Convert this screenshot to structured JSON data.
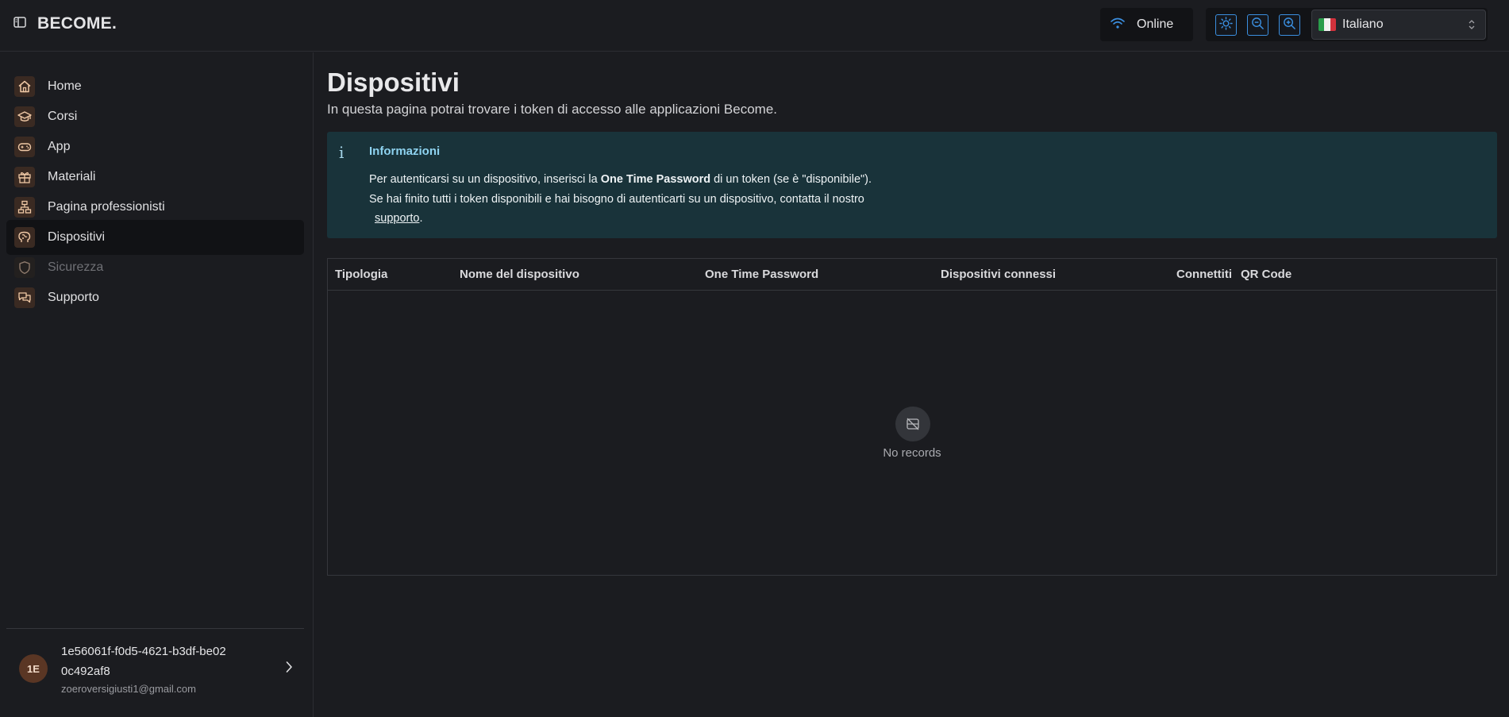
{
  "app": {
    "brand": "BECOME."
  },
  "header": {
    "status": "Online",
    "language": "Italiano",
    "accent_color": "#3b8fe0"
  },
  "sidebar": {
    "items": [
      {
        "label": "Home",
        "icon": "home-icon"
      },
      {
        "label": "Corsi",
        "icon": "graduation-cap-icon"
      },
      {
        "label": "App",
        "icon": "gamepad-icon"
      },
      {
        "label": "Materiali",
        "icon": "gift-icon"
      },
      {
        "label": "Pagina professionisti",
        "icon": "hierarchy-icon"
      },
      {
        "label": "Dispositivi",
        "icon": "brain-icon",
        "active": true
      },
      {
        "label": "Sicurezza",
        "icon": "shield-icon",
        "disabled": true
      },
      {
        "label": "Supporto",
        "icon": "chat-icon"
      }
    ],
    "user": {
      "initials": "1E",
      "id": "1e56061f-f0d5-4621-b3df-be020c492af8",
      "email": "zoeroversigiusti1@gmail.com"
    }
  },
  "main": {
    "title": "Dispositivi",
    "subtitle": "In questa pagina potrai trovare i token di accesso alle applicazioni Become.",
    "info": {
      "title": "Informazioni",
      "line1_pre": "Per autenticarsi su un dispositivo, inserisci la ",
      "line1_bold": "One Time Password",
      "line1_post": " di un token (se è \"disponibile\").",
      "line2": "Se hai finito tutti i token disponibili e hai bisogno di autenticarti su un dispositivo, contatta il nostro",
      "link": "supporto",
      "line3_post": "."
    },
    "table": {
      "columns": [
        "Tipologia",
        "Nome del dispositivo",
        "One Time Password",
        "Dispositivi connessi",
        "Connettiti",
        "QR Code"
      ],
      "rows": [],
      "empty_text": "No records"
    }
  }
}
